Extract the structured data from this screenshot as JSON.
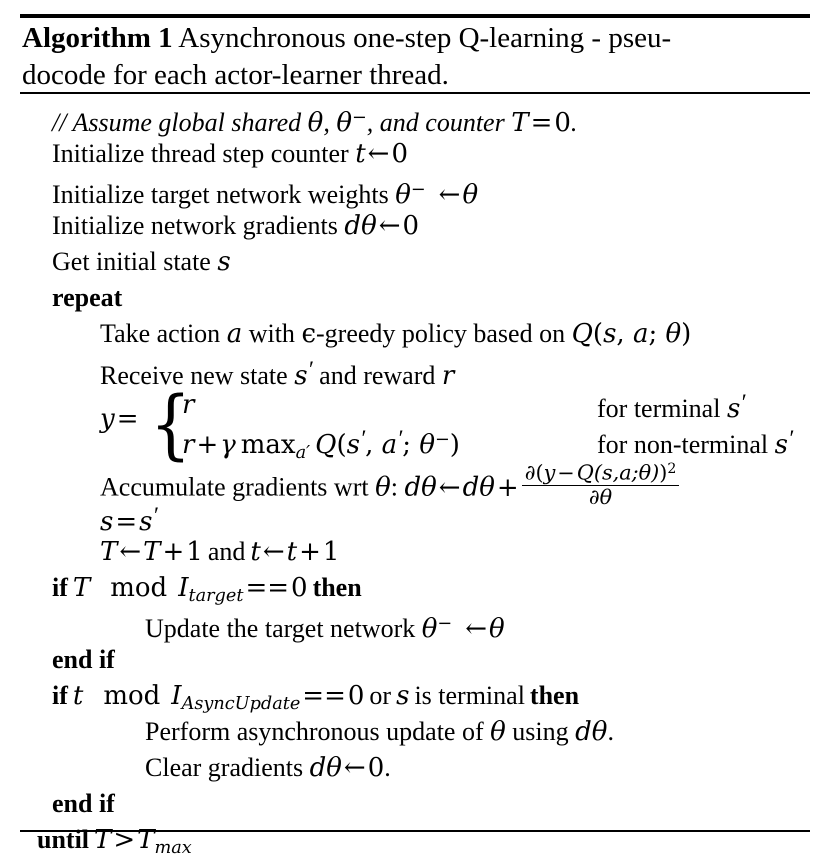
{
  "figure": {
    "kind": "algorithm-pseudocode",
    "label": "Algorithm 1",
    "title_line_1": "Asynchronous one-step Q-learning - pseu-",
    "title_line_2": "docode for each actor-learner thread.",
    "rule_color": "#000000",
    "text_color": "#000000",
    "background_color": "#ffffff"
  },
  "lines": {
    "comment_assume": {
      "pre": "// Assume global shared ",
      "theta": "θ",
      "comma1": ", ",
      "theta_minus_base": "θ",
      "theta_minus_sup": "−",
      "mid": ", and counter ",
      "T": "T",
      "eq": "=",
      "zero": "0",
      "period": "."
    },
    "init_thread_counter": {
      "text": "Initialize thread step counter ",
      "var": "t",
      "arrow": "←",
      "value": "0"
    },
    "init_target_weights": {
      "text": "Initialize target network weights ",
      "var_base": "θ",
      "var_sup": "−",
      "arrow": "←",
      "value": "θ"
    },
    "init_gradients": {
      "text": "Initialize network gradients ",
      "var_d": "d",
      "var_theta": "θ",
      "arrow": "←",
      "value": "0"
    },
    "get_initial_state": {
      "text": "Get initial state ",
      "var": "s"
    },
    "repeat": {
      "keyword": "repeat"
    },
    "take_action": {
      "pre": "Take action ",
      "action": "a",
      "mid": " with ",
      "epsilon": "ϵ",
      "policy": "-greedy policy based on ",
      "Q": "Q",
      "open": "(",
      "s": "s",
      "comma": ", ",
      "a": "a",
      "semi": "; ",
      "theta": "θ",
      "close": ")"
    },
    "receive_state": {
      "pre": "Receive new state ",
      "s_prime_base": "s",
      "s_prime_mark": "′",
      "mid": " and reward ",
      "r": "r"
    },
    "y_equation": {
      "lhs_y": "y",
      "lhs_eq": "=",
      "brace": "{",
      "case1_value": "r",
      "case1_condition_pre": "for terminal ",
      "case1_condition_var": "s",
      "case1_condition_prime": "′",
      "case2_r": "r",
      "case2_plus": "+",
      "case2_gamma": "γ",
      "case2_max": "max",
      "case2_max_sub": "a′",
      "case2_Q": "Q",
      "case2_open": "(",
      "case2_s": "s",
      "case2_s_prime": "′",
      "case2_comma": ", ",
      "case2_a": "a",
      "case2_a_prime": "′",
      "case2_semi": "; ",
      "case2_theta": "θ",
      "case2_theta_sup": "−",
      "case2_close": ")",
      "case2_condition_pre": "for non-terminal ",
      "case2_condition_var": "s",
      "case2_condition_prime": "′"
    },
    "accumulate_gradients": {
      "pre": "Accumulate gradients wrt ",
      "theta": "θ",
      "colon": ": ",
      "d1": "d",
      "theta1": "θ",
      "arrow": "←",
      "d2": "d",
      "theta2": "θ",
      "plus": "+",
      "frac_num_partial": "∂",
      "frac_num_open": "(",
      "frac_num_y": "y",
      "frac_num_minus": "−",
      "frac_num_Q": "Q",
      "frac_num_args": "(s,a;θ)",
      "frac_num_close": ")",
      "frac_num_sup": "2",
      "frac_den_partial": "∂",
      "frac_den_theta": "θ"
    },
    "s_assign": {
      "lhs": "s",
      "eq": "=",
      "rhs": "s",
      "rhs_prime": "′"
    },
    "counter_increment": {
      "T1": "T",
      "arrow1": "←",
      "T2": "T",
      "plus1": "+",
      "one1": "1",
      "and": "and",
      "t1": "t",
      "arrow2": "←",
      "t2": "t",
      "plus2": "+",
      "one2": "1"
    },
    "if_target": {
      "kw_if": "if",
      "var": "T",
      "mod": "mod",
      "I_base": "I",
      "I_sub": "target",
      "eqeq": "==",
      "zero": "0",
      "kw_then": "then"
    },
    "update_target": {
      "text": "Update the target network ",
      "theta_base": "θ",
      "theta_sup": "−",
      "arrow": "←",
      "value": "θ"
    },
    "end_if_1": {
      "keyword": "end if"
    },
    "if_async": {
      "kw_if": "if",
      "var": "t",
      "mod": "mod",
      "I_base": "I",
      "I_sub": "AsyncUpdate",
      "eqeq": "==",
      "zero": "0",
      "or": "or",
      "s": "s",
      "is_terminal": "is terminal",
      "kw_then": "then"
    },
    "perform_update": {
      "pre": "Perform asynchronous update of ",
      "theta": "θ",
      "mid": " using ",
      "d": "d",
      "theta2": "θ",
      "period": "."
    },
    "clear_gradients": {
      "pre": "Clear gradients ",
      "d": "d",
      "theta": "θ",
      "arrow": "←",
      "zero": "0",
      "period": "."
    },
    "end_if_2": {
      "keyword": "end if"
    },
    "until": {
      "keyword": "until",
      "T": "T",
      "gt": ">",
      "T_base": "T",
      "T_sub": "max"
    }
  }
}
